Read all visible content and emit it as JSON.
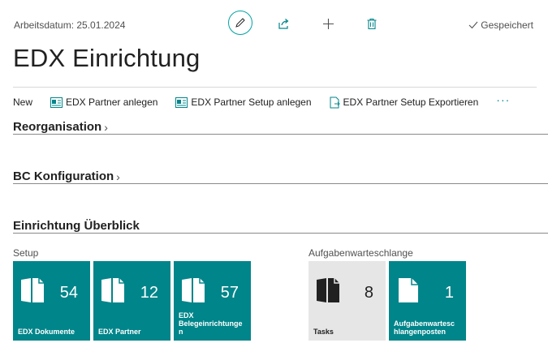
{
  "header": {
    "workdate": "Arbeitsdatum: 25.01.2024",
    "saved_label": "Gespeichert"
  },
  "page": {
    "title": "EDX Einrichtung"
  },
  "actions": {
    "new": "New",
    "partner_anlegen": "EDX Partner anlegen",
    "partner_setup_anlegen": "EDX Partner Setup anlegen",
    "partner_setup_export": "EDX Partner Setup Exportieren",
    "more": "···"
  },
  "sections": {
    "reorg": "Reorganisation",
    "bc_konfig": "BC Konfiguration",
    "overview": "Einrichtung Überblick"
  },
  "groups": {
    "setup": {
      "label": "Setup",
      "tiles": [
        {
          "value": "54",
          "label": "EDX Dokumente"
        },
        {
          "value": "12",
          "label": "EDX Partner"
        },
        {
          "value": "57",
          "label": "EDX Belegeinrichtunge n"
        }
      ]
    },
    "queue": {
      "label": "Aufgabenwarteschlange",
      "tiles": [
        {
          "value": "8",
          "label": "Tasks"
        },
        {
          "value": "1",
          "label": "Aufgabenwartesc hlangenposten"
        }
      ]
    }
  },
  "colors": {
    "accent": "#00858a",
    "tile_gray": "#e6e6e6",
    "text": "#212121"
  }
}
